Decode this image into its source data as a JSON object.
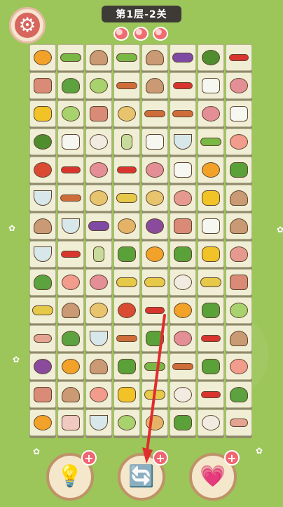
{
  "header": {
    "level_text": "第1层-2关",
    "lives": 3
  },
  "buttons": {
    "settings_icon": "gear-icon",
    "hint_icon": "lightbulb-icon",
    "shuffle_icon": "refresh-icon",
    "revive_icon": "heart-plus-icon",
    "plus_label": "+"
  },
  "board": {
    "rows": [
      [
        "pumpkin",
        "peas",
        "mushroom",
        "peas",
        "mushroom",
        "eggplant",
        "broccoli",
        "chili"
      ],
      [
        "meat",
        "bokchoy",
        "cabbage",
        "sausage",
        "mushroom",
        "chili",
        "tofu",
        "steak"
      ],
      [
        "pepper-y",
        "cabbage",
        "meat",
        "ginger",
        "sausage",
        "sausage",
        "steak",
        "tofu"
      ],
      [
        "broccoli",
        "tofu",
        "garlic",
        "celery",
        "tofu",
        "soup",
        "peas",
        "shrimp"
      ],
      [
        "tomato",
        "chili",
        "steak",
        "chili",
        "steak",
        "tofu",
        "pumpkin",
        "pepper-g"
      ],
      [
        "soup",
        "sausage",
        "ginger",
        "corn",
        "ginger",
        "ham",
        "pepper-y",
        "mushroom"
      ],
      [
        "mushroom",
        "soup",
        "eggplant",
        "lotus",
        "fig",
        "meat",
        "tofu",
        "mushroom"
      ],
      [
        "soup",
        "chili",
        "celery",
        "pepper-g",
        "pumpkin",
        "pepper-g",
        "pepper-y",
        "ham"
      ],
      [
        "bokchoy",
        "shrimp",
        "steak",
        "corn",
        "corn",
        "garlic",
        "corn",
        "meat"
      ],
      [
        "corn",
        "mushroom",
        "ginger",
        "tomato",
        "chili",
        "pumpkin",
        "pepper-g",
        "cabbage"
      ],
      [
        "bacon",
        "bokchoy",
        "soup",
        "sausage",
        "pepper-g",
        "steak",
        "chili",
        "mushroom"
      ],
      [
        "fig",
        "pumpkin",
        "mushroom",
        "pepper-g",
        "peas",
        "sausage",
        "pepper-g",
        "shrimp"
      ],
      [
        "meat",
        "mushroom",
        "shrimp",
        "pepper-y",
        "corn",
        "garlic",
        "chili",
        "bokchoy"
      ],
      [
        "pumpkin",
        "pork",
        "soup",
        "cabbage",
        "lotus",
        "pepper-g",
        "garlic",
        "bacon"
      ]
    ]
  }
}
